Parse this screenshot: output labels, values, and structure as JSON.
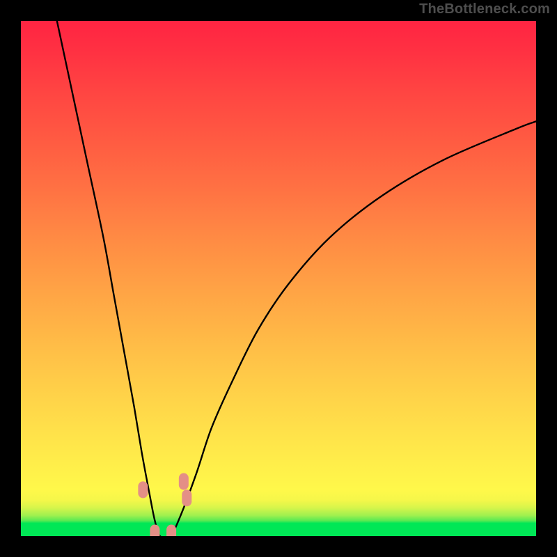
{
  "watermark": "TheBottleneck.com",
  "colors": {
    "frame": "#000000",
    "curve": "#000000",
    "marker_fill": "#e48f86",
    "gradient_top": "#ff2442",
    "gradient_bottom": "#00e756"
  },
  "chart_data": {
    "type": "line",
    "title": "",
    "xlabel": "",
    "ylabel": "",
    "xlim": [
      0,
      100
    ],
    "ylim": [
      0,
      100
    ],
    "series": [
      {
        "name": "bottleneck-curve",
        "x": [
          7,
          10,
          13,
          16,
          18,
          20,
          22,
          23.5,
          25,
          26,
          27,
          29,
          31,
          34,
          37,
          41,
          46,
          52,
          60,
          70,
          82,
          96,
          100
        ],
        "y": [
          100,
          86,
          72,
          58,
          47,
          36,
          25,
          16,
          8,
          3,
          0,
          0,
          4,
          12,
          21,
          30,
          40,
          49,
          58,
          66,
          73,
          79,
          80.5
        ]
      }
    ],
    "markers": [
      {
        "name": "optimal-left",
        "x": 23.7,
        "y": 9.0
      },
      {
        "name": "optimal-bottom-a",
        "x": 26.0,
        "y": 0.6
      },
      {
        "name": "optimal-bottom-b",
        "x": 29.2,
        "y": 0.6
      },
      {
        "name": "optimal-right-a",
        "x": 31.6,
        "y": 10.6
      },
      {
        "name": "optimal-right-b",
        "x": 32.2,
        "y": 7.4
      }
    ]
  }
}
